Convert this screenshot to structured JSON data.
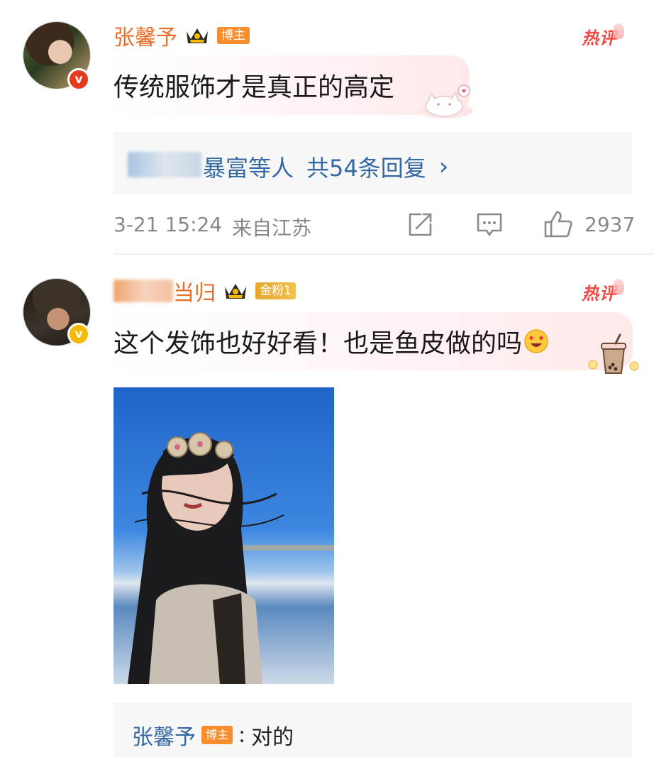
{
  "comments": [
    {
      "username": "张馨予",
      "badge": "博主",
      "hot_label": "热评",
      "text": "传统服饰才是真正的高定",
      "replies_preview": {
        "suffix": "暴富等人",
        "link": "共54条回复",
        "chevron": "›"
      },
      "meta": {
        "time": "3-21 15:24",
        "location": "来自江苏",
        "likes": "2937"
      }
    },
    {
      "username_visible": "当归",
      "badge": "金粉1",
      "hot_label": "热评",
      "text": "这个发饰也好好看！也是鱼皮做的吗",
      "emoji": "😍",
      "image": {
        "alt": "headband-selfie-photo"
      },
      "author_reply": {
        "name": "张馨予",
        "badge": "博主",
        "separator": ":",
        "text": "对的"
      }
    }
  ],
  "colors": {
    "username": "#e86e27",
    "link": "#3569a3",
    "hot": "#f04a44",
    "badge_blogger": "#f88d2d",
    "badge_fan": "#e6a62d",
    "verified_red": "#e63a1f",
    "verified_gold": "#f6b800"
  },
  "icons": [
    "crown-icon",
    "verified-icon",
    "share-icon",
    "comment-icon",
    "like-icon",
    "chevron-right-icon",
    "emoji-icon",
    "cat-sticker-icon",
    "milk-tea-sticker-icon"
  ]
}
